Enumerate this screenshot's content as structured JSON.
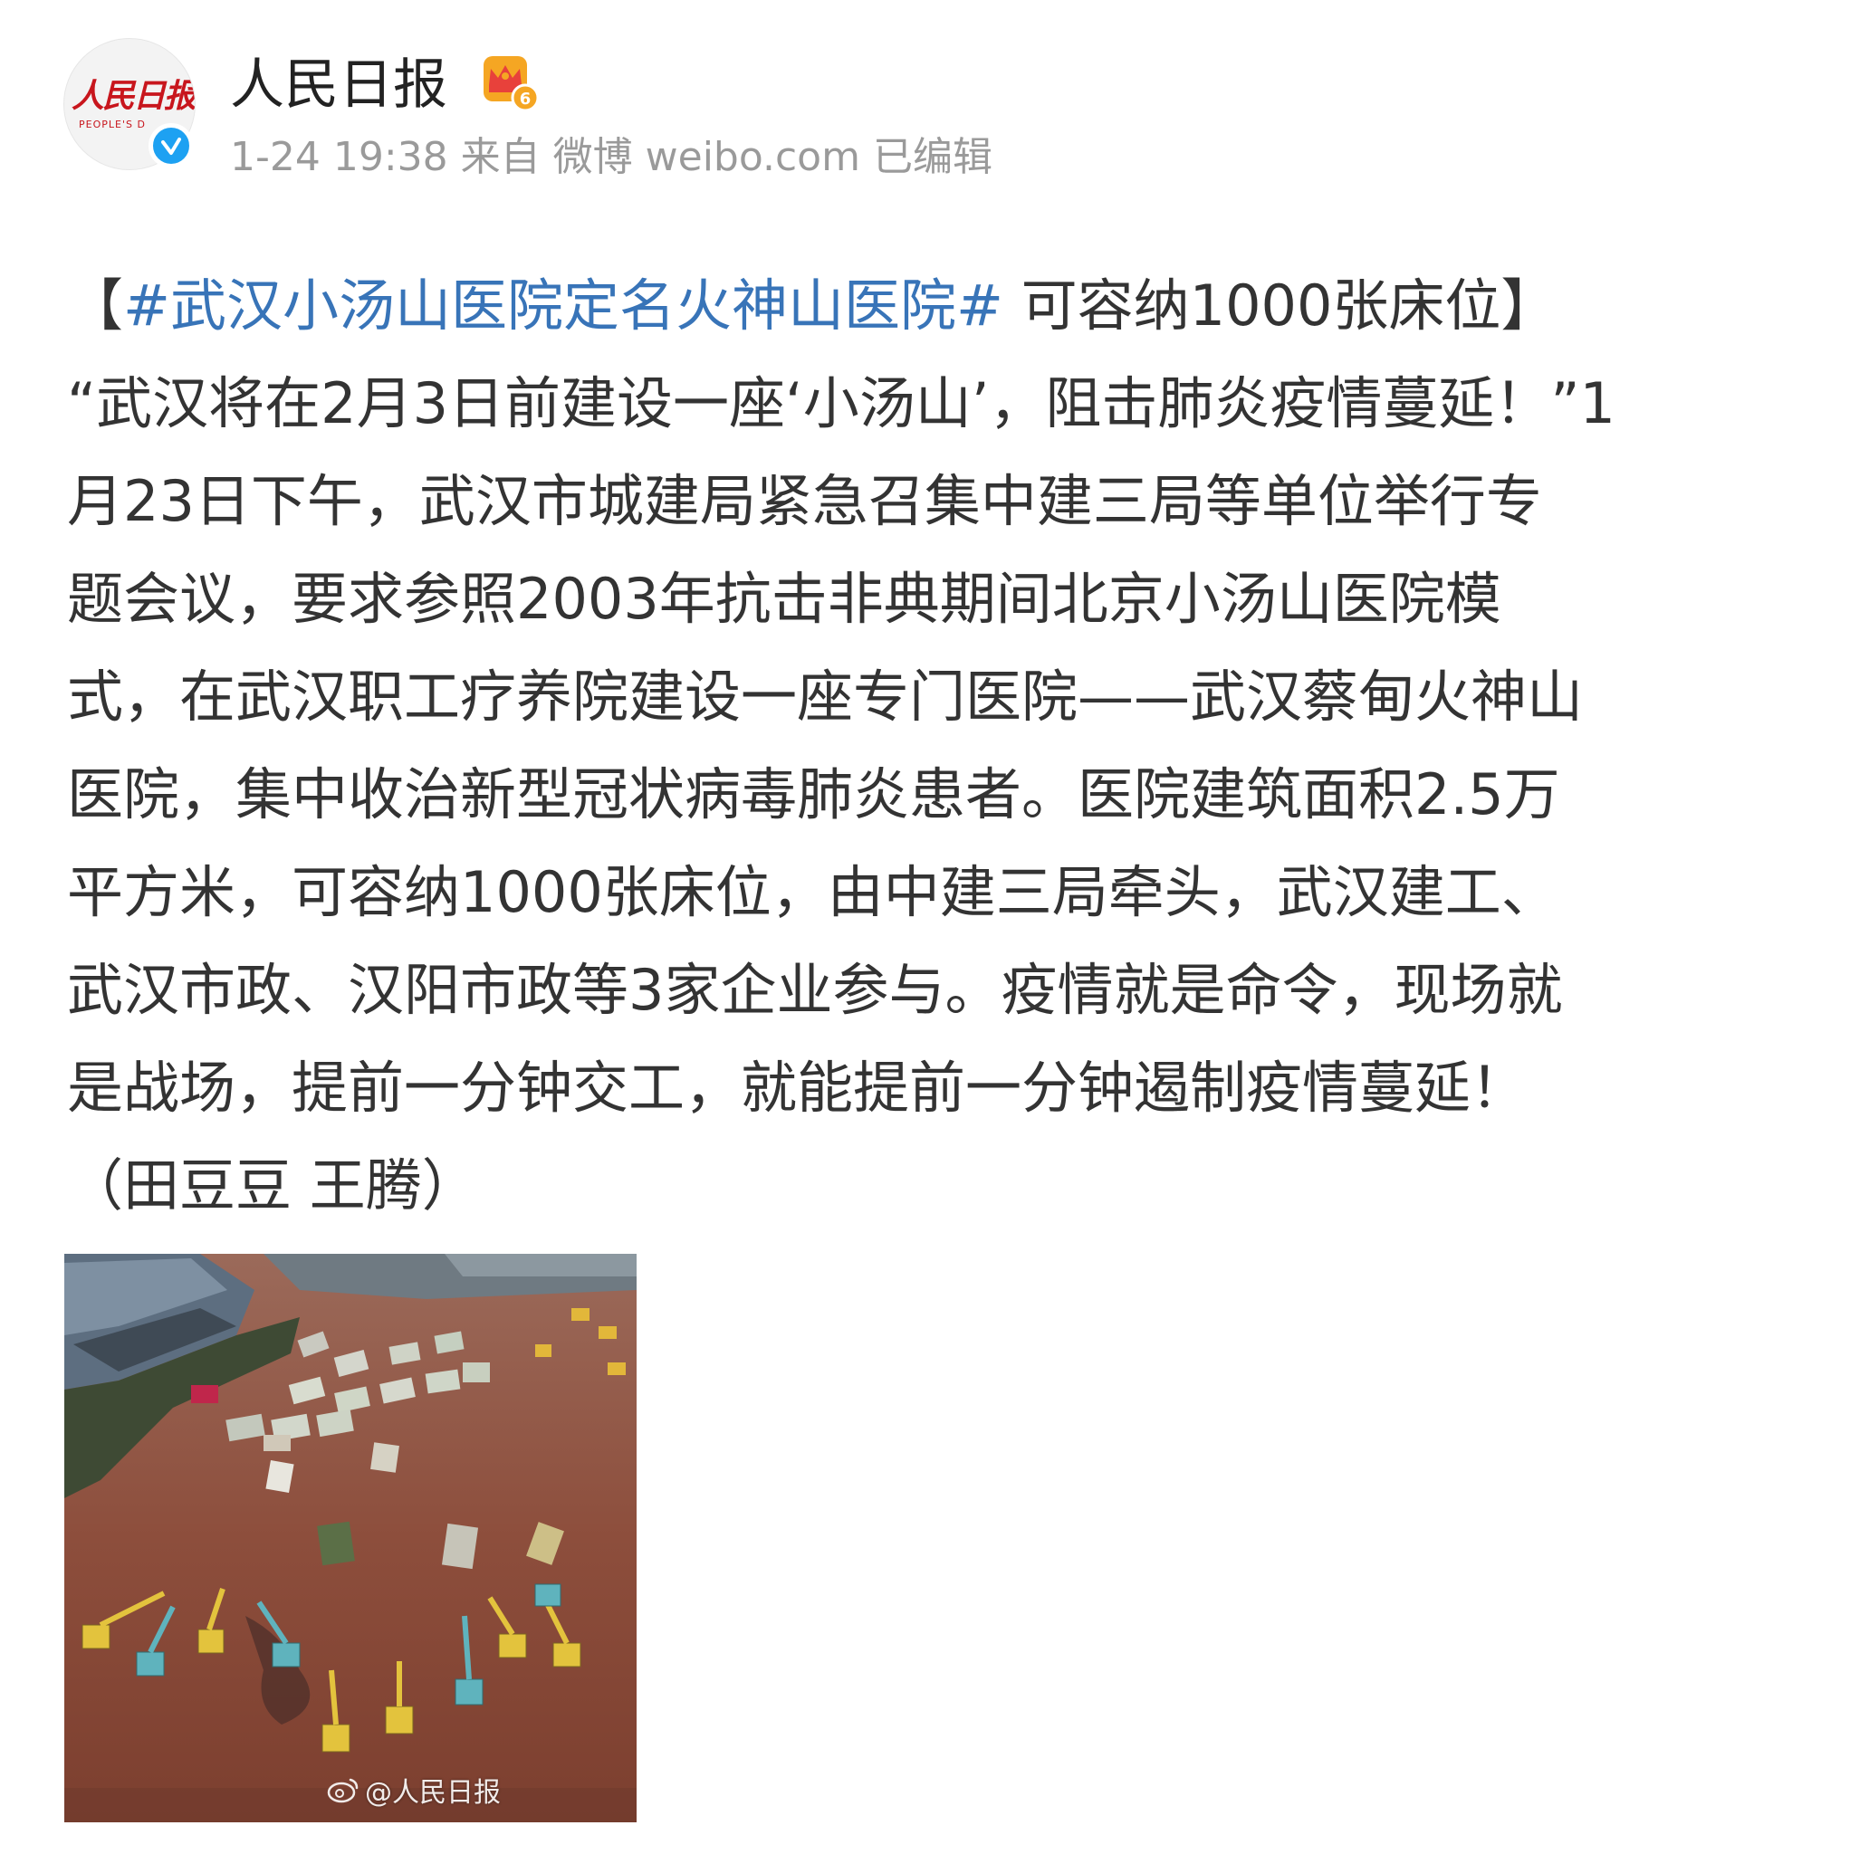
{
  "header": {
    "avatar_logo_text": "人民日报",
    "avatar_sub_text": "PEOPLE'S D",
    "username": "人民日报",
    "date": "1-24 19:38",
    "source_prefix": "来自",
    "source_client": "微博 weibo.com",
    "edited_label": "已编辑",
    "verified_color": "#1da1f2",
    "badge_icon": "crown-icon"
  },
  "post": {
    "bracket_open": "【",
    "hashtag": "#武汉小汤山医院定名火神山医院#",
    "headline_rest": " 可容纳1000张床位",
    "bracket_close": "】",
    "lines": [
      "“武汉将在2月3日前建设一座‘小汤山’，阻击肺炎疫情蔓延！”1",
      "月23日下午，武汉市城建局紧急召集中建三局等单位举行专",
      "题会议，要求参照2003年抗击非典期间北京小汤山医院模",
      "式，在武汉职工疗养院建设一座专门医院——武汉蔡甸火神山",
      "医院，集中收治新型冠状病毒肺炎患者。医院建筑面积2.5万",
      "平方米，可容纳1000张床位，由中建三局牵头，武汉建工、",
      "武汉市政、汉阳市政等3家企业参与。疫情就是命令，现场就",
      "是战场，提前一分钟交工，就能提前一分钟遏制疫情蔓延！",
      "（田豆豆 王腾）"
    ],
    "hashtag_color": "#3874b8"
  },
  "image": {
    "watermark": "@人民日报"
  }
}
